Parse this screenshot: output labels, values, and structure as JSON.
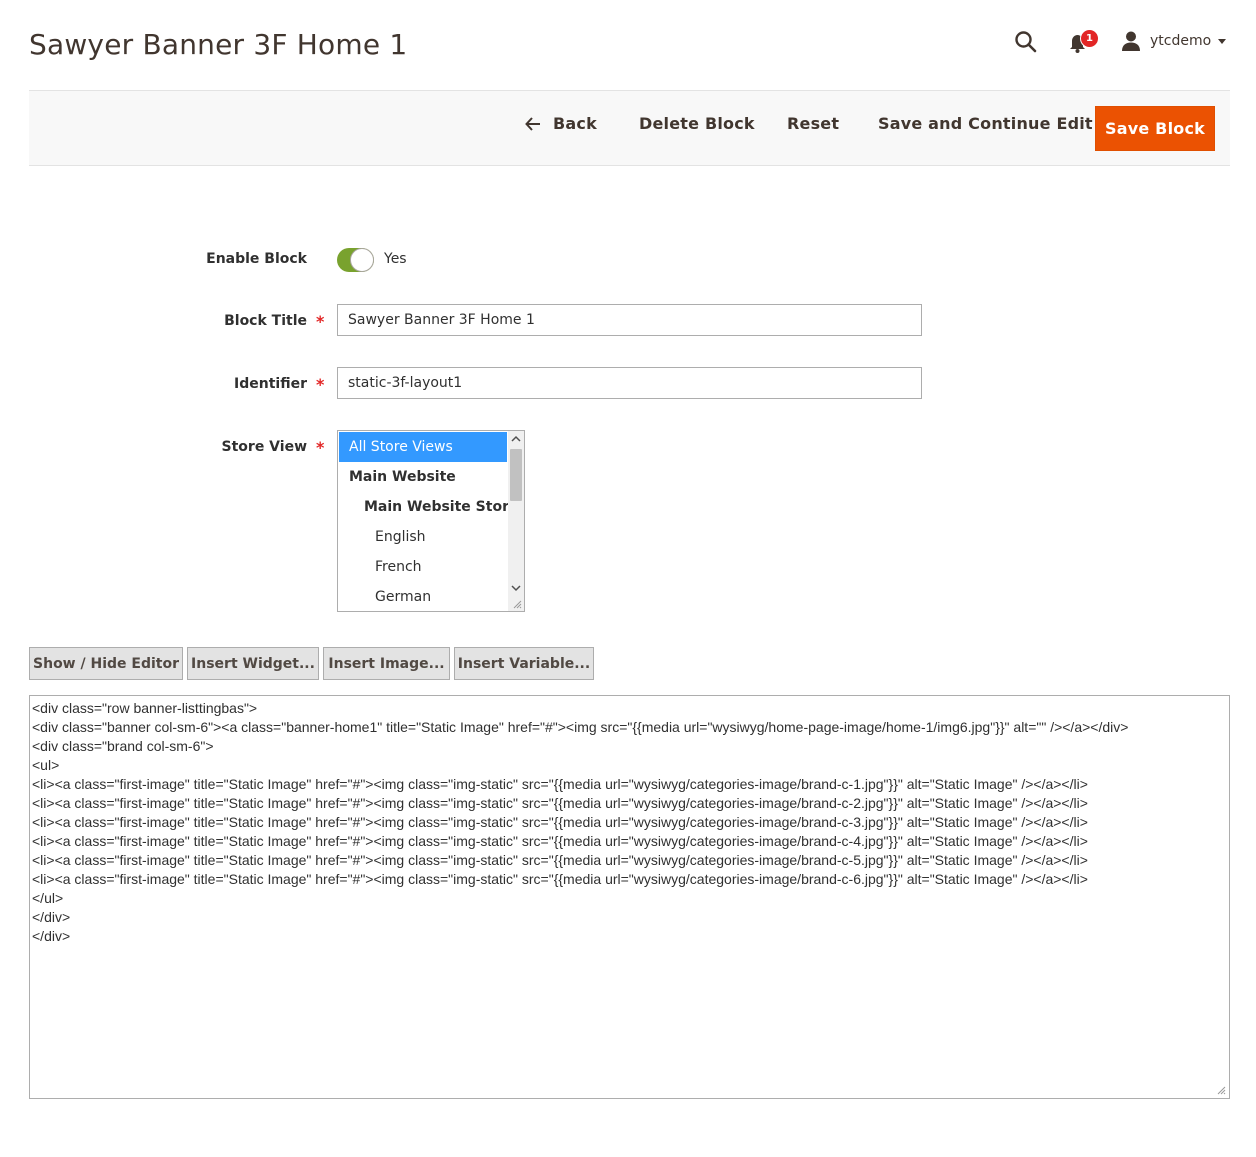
{
  "page": {
    "title": "Sawyer Banner 3F Home 1"
  },
  "header": {
    "notifications_count": "1",
    "username": "ytcdemo"
  },
  "toolbar": {
    "back_label": "Back",
    "delete_label": "Delete Block",
    "reset_label": "Reset",
    "save_continue_label": "Save and Continue Edit",
    "save_label": "Save Block"
  },
  "form": {
    "enable_block": {
      "label": "Enable Block",
      "value": "Yes",
      "enabled": true
    },
    "block_title": {
      "label": "Block Title",
      "value": "Sawyer Banner 3F Home 1",
      "required": true
    },
    "identifier": {
      "label": "Identifier",
      "value": "static-3f-layout1",
      "required": true
    },
    "store_view": {
      "label": "Store View",
      "required": true,
      "options": [
        {
          "label": "All Store Views",
          "level": 0,
          "selected": true
        },
        {
          "label": "Main Website",
          "level": 1,
          "selected": false
        },
        {
          "label": "Main Website Store",
          "level": 2,
          "selected": false
        },
        {
          "label": "English",
          "level": 3,
          "selected": false
        },
        {
          "label": "French",
          "level": 3,
          "selected": false
        },
        {
          "label": "German",
          "level": 3,
          "selected": false
        }
      ]
    }
  },
  "editor": {
    "buttons": {
      "show_hide": "Show / Hide Editor",
      "insert_widget": "Insert Widget...",
      "insert_image": "Insert Image...",
      "insert_variable": "Insert Variable..."
    },
    "content_lines": [
      "<div class=\"row banner-listtingbas\">",
      "<div class=\"banner col-sm-6\"><a class=\"banner-home1\" title=\"Static Image\" href=\"#\"><img src=\"{{media url=\"wysiwyg/home-page-image/home-1/img6.jpg\"}}\" alt=\"\" /></a></div>",
      "<div class=\"brand col-sm-6\">",
      "<ul>",
      "<li><a class=\"first-image\" title=\"Static Image\" href=\"#\"><img class=\"img-static\" src=\"{{media url=\"wysiwyg/categories-image/brand-c-1.jpg\"}}\" alt=\"Static Image\" /></a></li>",
      "<li><a class=\"first-image\" title=\"Static Image\" href=\"#\"><img class=\"img-static\" src=\"{{media url=\"wysiwyg/categories-image/brand-c-2.jpg\"}}\" alt=\"Static Image\" /></a></li>",
      "<li><a class=\"first-image\" title=\"Static Image\" href=\"#\"><img class=\"img-static\" src=\"{{media url=\"wysiwyg/categories-image/brand-c-3.jpg\"}}\" alt=\"Static Image\" /></a></li>",
      "<li><a class=\"first-image\" title=\"Static Image\" href=\"#\"><img class=\"img-static\" src=\"{{media url=\"wysiwyg/categories-image/brand-c-4.jpg\"}}\" alt=\"Static Image\" /></a></li>",
      "<li><a class=\"first-image\" title=\"Static Image\" href=\"#\"><img class=\"img-static\" src=\"{{media url=\"wysiwyg/categories-image/brand-c-5.jpg\"}}\" alt=\"Static Image\" /></a></li>",
      "<li><a class=\"first-image\" title=\"Static Image\" href=\"#\"><img class=\"img-static\" src=\"{{media url=\"wysiwyg/categories-image/brand-c-6.jpg\"}}\" alt=\"Static Image\" /></a></li>",
      "</ul>",
      "</div>",
      "</div>"
    ]
  },
  "colors": {
    "primary_button": "#eb5202",
    "toggle_on": "#79a22e",
    "required": "#e22626",
    "selected_option": "#3399ff",
    "badge": "#e22626"
  },
  "icons": {
    "search": "search-icon",
    "notifications": "bell-icon",
    "user": "user-icon",
    "back": "arrow-left-icon"
  }
}
